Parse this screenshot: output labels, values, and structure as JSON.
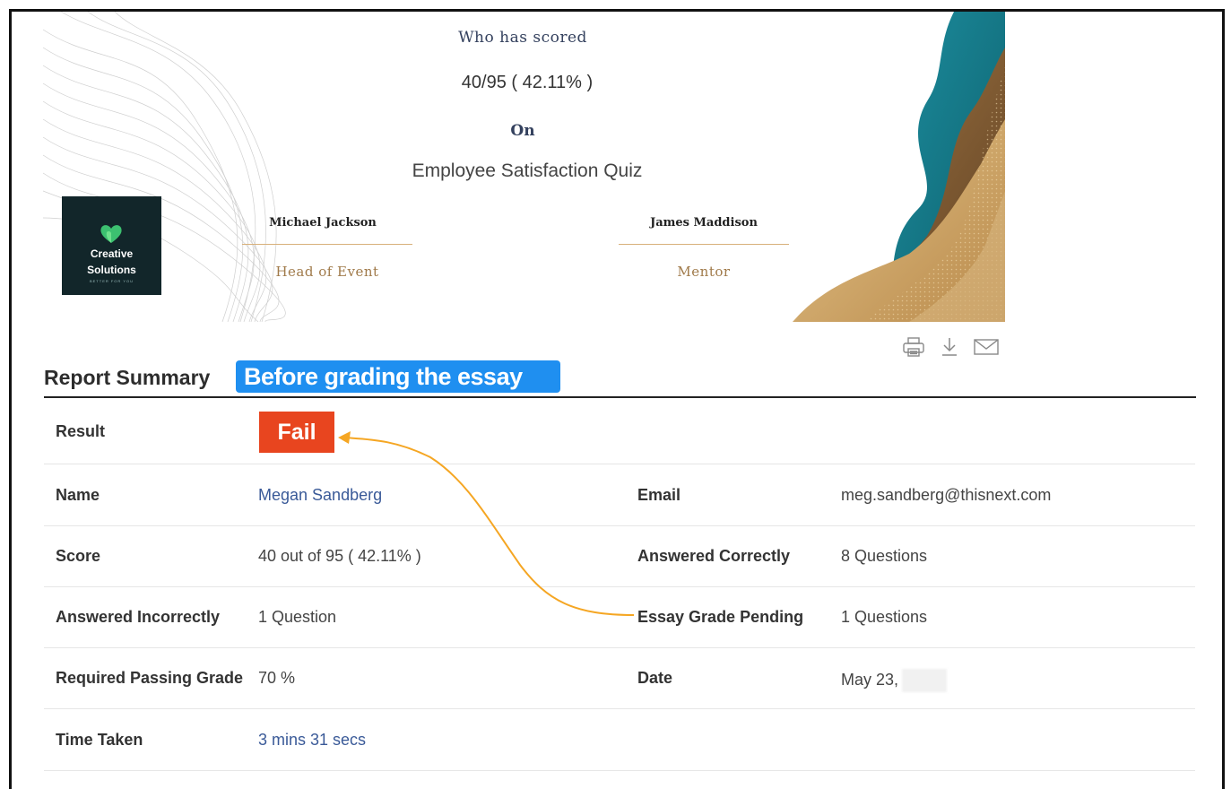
{
  "certificate": {
    "who_scored": "Who has scored",
    "score": "40/95 ( 42.11% )",
    "on": "On",
    "quiz_name": "Employee Satisfaction Quiz",
    "logo": {
      "line1": "Creative",
      "line2": "Solutions",
      "tagline": "BETTER FOR YOU"
    },
    "signatures": [
      {
        "name": "Michael Jackson",
        "role": "Head of Event"
      },
      {
        "name": "James Maddison",
        "role": "Mentor"
      }
    ],
    "colors": {
      "teal": "#167f8f",
      "gold": "#c9a165",
      "brown": "#7d5a32",
      "signature_line": "#d8b07a"
    }
  },
  "actions": [
    {
      "icon": "print-icon"
    },
    {
      "icon": "download-icon"
    },
    {
      "icon": "email-icon"
    }
  ],
  "report": {
    "title": "Report Summary",
    "callout": "Before grading the essay",
    "result_label": "Result",
    "result_value": "Fail",
    "rows": [
      {
        "label1": "Name",
        "value1": "Megan Sandberg",
        "label2": "Email",
        "value2": "meg.sandberg@thisnext.com"
      },
      {
        "label1": "Score",
        "value1": "40 out of 95 ( 42.11% )",
        "label2": "Answered Correctly",
        "value2": "8  Questions"
      },
      {
        "label1": "Answered Incorrectly",
        "value1": "1  Question",
        "label2": "Essay Grade Pending",
        "value2": "1  Questions"
      },
      {
        "label1": "Required Passing Grade",
        "value1": "70 %",
        "label2": "Date",
        "value2": "May 23,"
      },
      {
        "label1": "Time Taken",
        "value1": "3 mins 31 secs",
        "label2": "",
        "value2": ""
      }
    ],
    "colors": {
      "fail": "#e8451f",
      "callout": "#1f8ff0",
      "arrow": "#f5a623",
      "link": "#3a5a98"
    }
  }
}
